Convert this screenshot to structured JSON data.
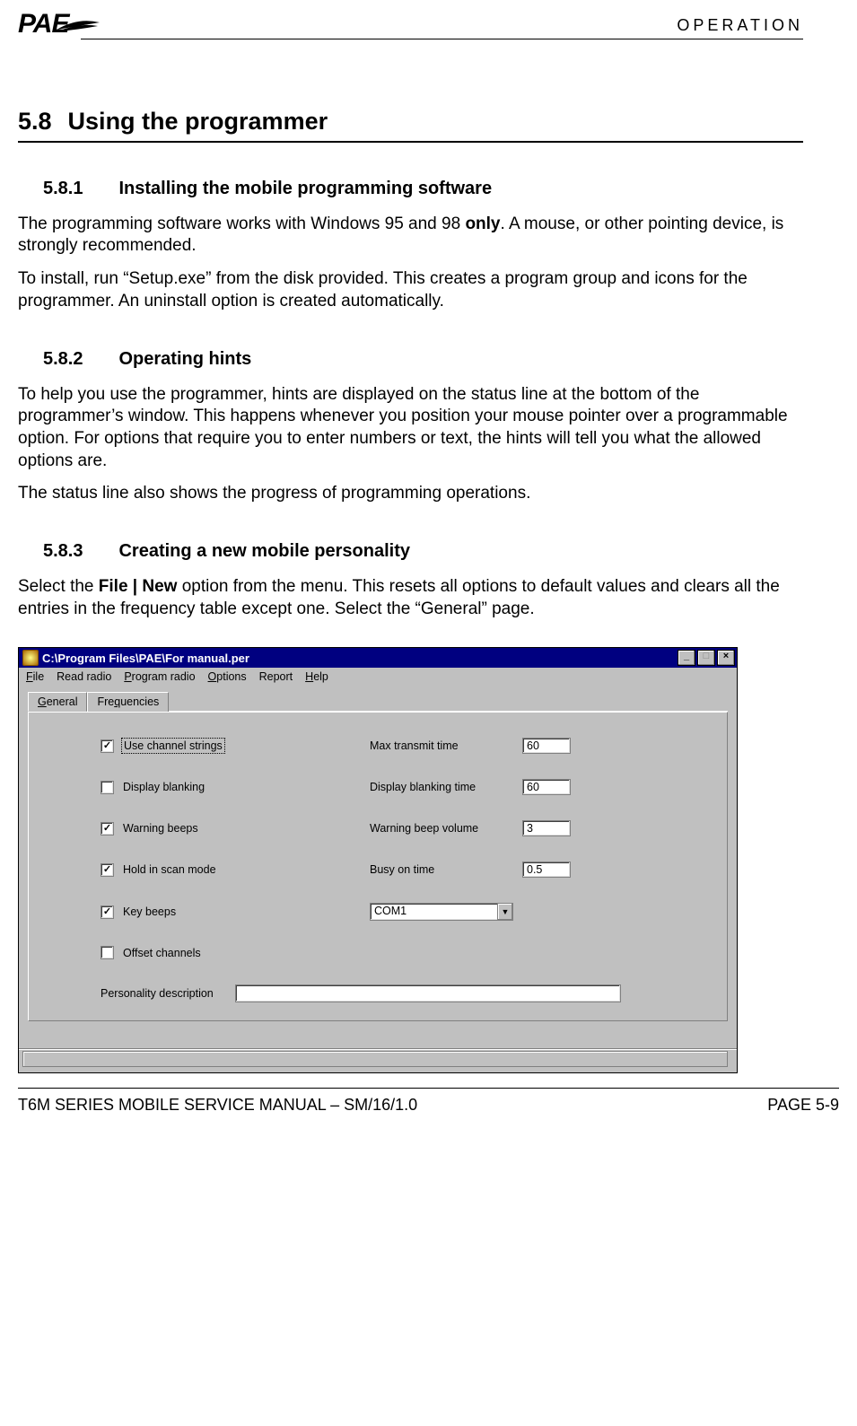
{
  "header": {
    "logo_text": "PAE",
    "category": "OPERATION"
  },
  "section": {
    "number": "5.8",
    "title": "Using the programmer"
  },
  "sub1": {
    "number": "5.8.1",
    "title": "Installing the mobile programming software",
    "p1_a": "The programming software works with Windows 95 and 98 ",
    "p1_b": "only",
    "p1_c": ".  A mouse, or other pointing device, is strongly recommended.",
    "p2": "To install, run “Setup.exe” from the disk provided.  This creates a program group and icons for the programmer.  An uninstall option is created automatically."
  },
  "sub2": {
    "number": "5.8.2",
    "title": "Operating hints",
    "p1": "To help you use the programmer,  hints are displayed on the status line at the bottom of the programmer’s window.  This happens whenever you position your mouse pointer over a programmable option.   For options that require you to enter numbers or text, the hints will tell you what the allowed options are.",
    "p2": "The status line also shows the progress of programming operations."
  },
  "sub3": {
    "number": "5.8.3",
    "title": "Creating a new mobile personality",
    "p1_a": "Select the ",
    "p1_b": "File | New",
    "p1_c": " option from the menu.   This resets all options to default values and clears all the entries in the frequency table except one.   Select the “General” page."
  },
  "window": {
    "title": "C:\\Program Files\\PAE\\For manual.per",
    "menu": {
      "file": "File",
      "read": "Read radio",
      "program": "Program radio",
      "options": "Options",
      "report": "Report",
      "help": "Help"
    },
    "tabs": {
      "general": "General",
      "frequencies": "Frequencies"
    },
    "form": {
      "use_channel_strings": {
        "label": "Use channel strings",
        "checked": true
      },
      "display_blanking": {
        "label": "Display blanking",
        "checked": false
      },
      "warning_beeps": {
        "label": "Warning beeps",
        "checked": true
      },
      "hold_in_scan": {
        "label": "Hold in scan mode",
        "checked": true
      },
      "key_beeps": {
        "label": "Key beeps",
        "checked": true
      },
      "offset_channels": {
        "label": "Offset channels",
        "checked": false
      },
      "max_transmit_time": {
        "label": "Max transmit time",
        "value": "60"
      },
      "display_blanking_time": {
        "label": "Display blanking time",
        "value": "60"
      },
      "warning_beep_volume": {
        "label": "Warning beep volume",
        "value": "3"
      },
      "busy_on_time": {
        "label": "Busy on time",
        "value": "0.5"
      },
      "port": {
        "value": "COM1"
      },
      "personality_desc": {
        "label": "Personality description",
        "value": ""
      }
    }
  },
  "footer": {
    "left": "T6M SERIES MOBILE SERVICE MANUAL – SM/16/1.0",
    "right": "PAGE 5-9"
  }
}
